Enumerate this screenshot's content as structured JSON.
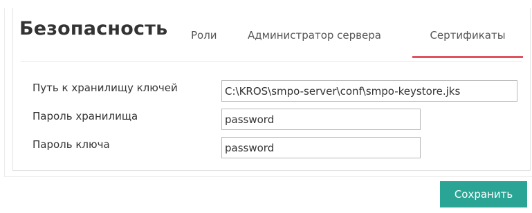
{
  "header": {
    "title": "Безопасность"
  },
  "tabs": [
    {
      "label": "Роли",
      "active": false
    },
    {
      "label": "Администратор сервера",
      "active": false
    },
    {
      "label": "Сертификаты",
      "active": true
    }
  ],
  "colors": {
    "active_tab_underline": "#e0525e",
    "save_button": "#2aa595"
  },
  "form": {
    "keystore_path": {
      "label": "Путь к хранилищу ключей",
      "value": "C:\\KROS\\smpo-server\\conf\\smpo-keystore.jks"
    },
    "store_password": {
      "label": "Пароль хранилища",
      "value": "password"
    },
    "key_password": {
      "label": "Пароль ключа",
      "value": "password"
    }
  },
  "actions": {
    "save_label": "Сохранить"
  }
}
